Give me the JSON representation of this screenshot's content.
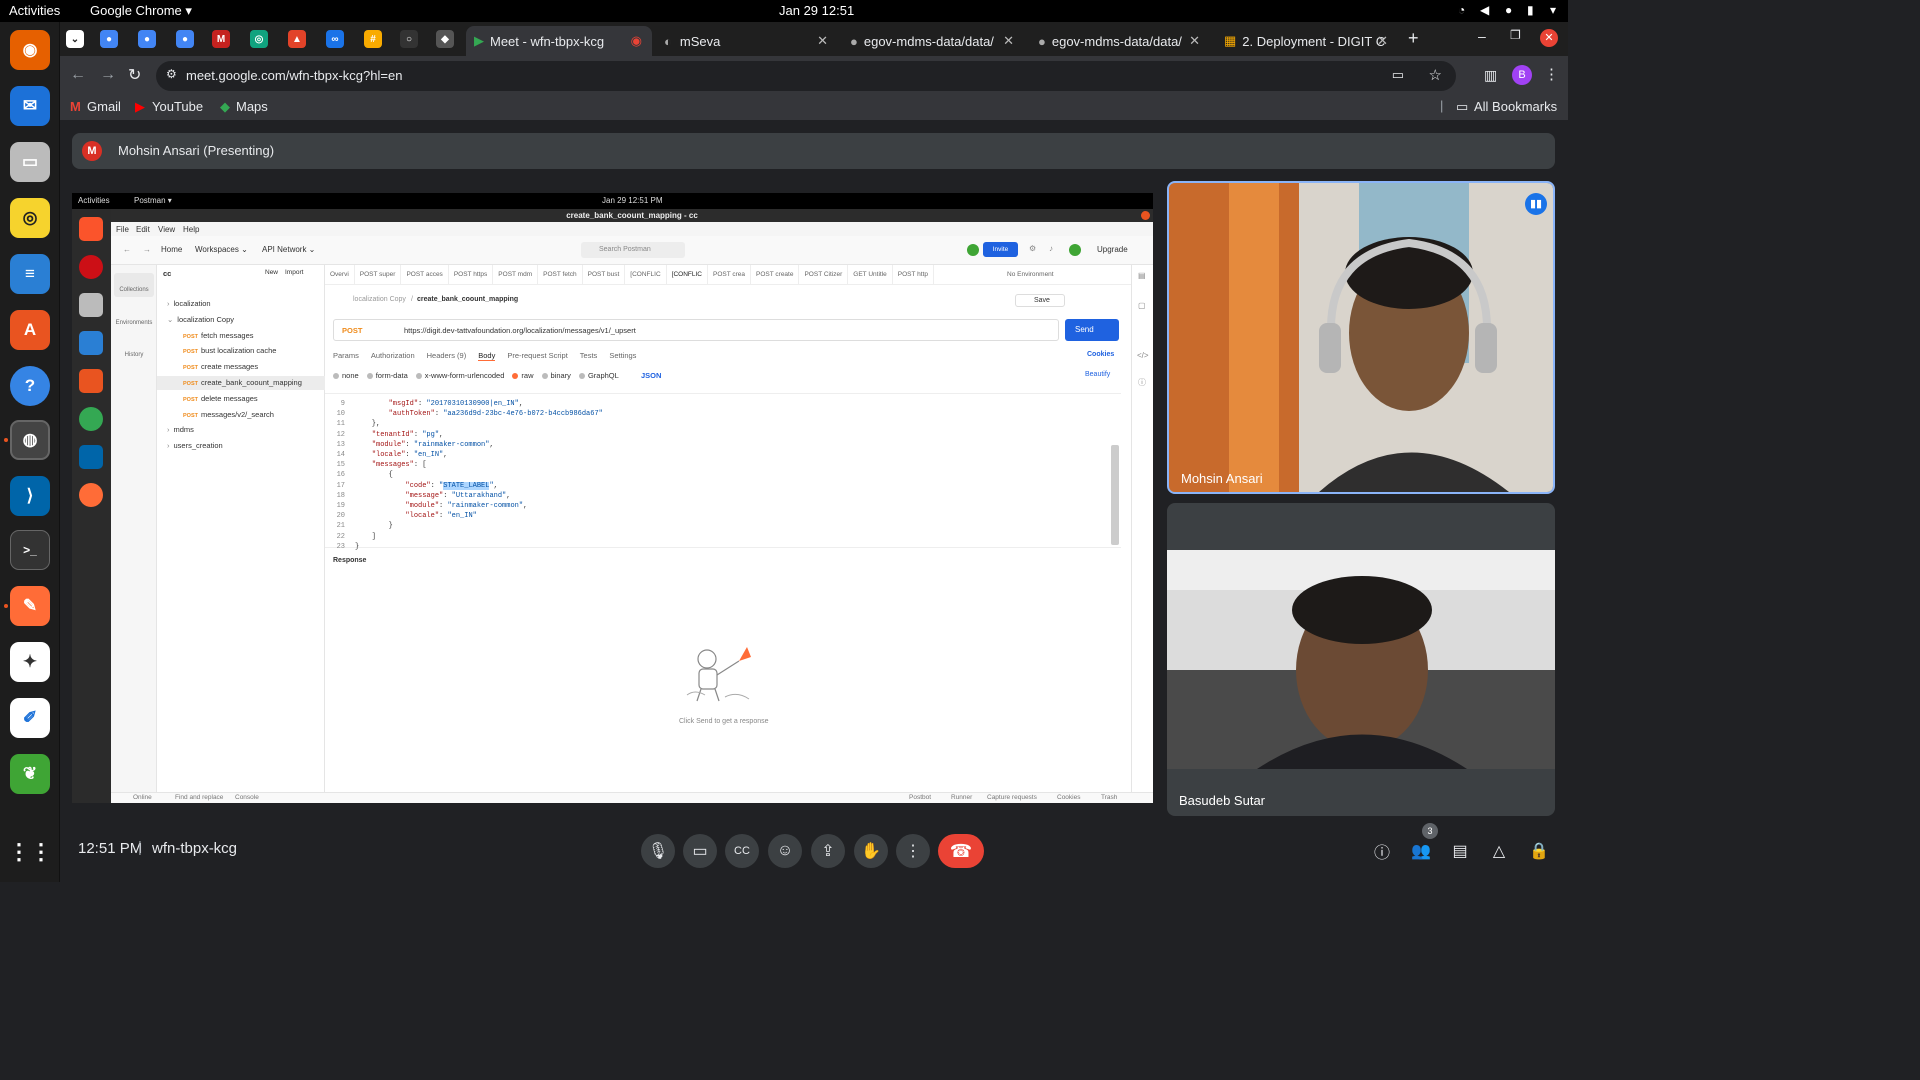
{
  "os": {
    "activities": "Activities",
    "app": "Google Chrome ▾",
    "datetime": "Jan 29  12:51"
  },
  "chrome": {
    "tabs": [
      {
        "label": "Meet - wfn-tbpx-kcg"
      },
      {
        "label": "mSeva"
      },
      {
        "label": "egov-mdms-data/data/"
      },
      {
        "label": "egov-mdms-data/data/"
      },
      {
        "label": "2. Deployment - DIGIT C"
      }
    ],
    "url": "meet.google.com/wfn-tbpx-kcg?hl=en",
    "bookmarks": [
      "Gmail",
      "YouTube",
      "Maps"
    ],
    "all_bookmarks": "All Bookmarks",
    "profile_initial": "B"
  },
  "meet": {
    "presenting": "Mohsin Ansari (Presenting)",
    "presenter_initial": "M",
    "time": "12:51 PM",
    "separator": "|",
    "code": "wfn-tbpx-kcg",
    "participant_count": "3",
    "participants": [
      {
        "name": "Mohsin Ansari"
      },
      {
        "name": "Basudeb Sutar"
      }
    ]
  },
  "postman": {
    "topbar_activities": "Activities",
    "topbar_app": "Postman ▾",
    "topbar_date": "Jan 29  12:51 PM",
    "window_title": "create_bank_coount_mapping - cc",
    "menu": [
      "File",
      "Edit",
      "View",
      "Help"
    ],
    "nav": {
      "home": "Home",
      "workspaces": "Workspaces ⌄",
      "network": "API Network ⌄",
      "search": "Search Postman",
      "invite": "Invite",
      "upgrade": "Upgrade"
    },
    "workspace": "cc",
    "new": "New",
    "import": "Import",
    "side": [
      "Collections",
      "Environments",
      "History"
    ],
    "tree": [
      {
        "label": "localization",
        "method": "",
        "caret": "›"
      },
      {
        "label": "localization Copy",
        "method": "",
        "caret": "⌄"
      },
      {
        "label": "fetch messages",
        "method": "POST",
        "caret": ""
      },
      {
        "label": "bust localization cache",
        "method": "POST",
        "caret": ""
      },
      {
        "label": "create messages",
        "method": "POST",
        "caret": ""
      },
      {
        "label": "create_bank_coount_mapping",
        "method": "POST",
        "caret": ""
      },
      {
        "label": "delete messages",
        "method": "POST",
        "caret": ""
      },
      {
        "label": "messages/v2/_search",
        "method": "POST",
        "caret": ""
      },
      {
        "label": "mdms",
        "method": "",
        "caret": "›"
      },
      {
        "label": "users_creation",
        "method": "",
        "caret": "›"
      }
    ],
    "req_tabs": [
      "Overvi",
      "POST super",
      "POST acces",
      "POST https",
      "POST mdm",
      "POST fetch",
      "POST bust",
      "[CONFLIC",
      "[CONFLIC",
      "POST crea",
      "POST create",
      "POST Citizer",
      "GET Untitle",
      "POST http"
    ],
    "environment": "No Environment",
    "breadcrumb_parent": "localization Copy",
    "breadcrumb_sep": "/",
    "request_name": "create_bank_coount_mapping",
    "save": "Save",
    "method": "POST",
    "url": "https://digit.dev-tattvafoundation.org/localization/messages/v1/_upsert",
    "send": "Send",
    "subtabs": [
      "Params",
      "Authorization",
      "Headers (9)",
      "Body",
      "Pre-request Script",
      "Tests",
      "Settings"
    ],
    "cookies": "Cookies",
    "body_types": [
      "none",
      "form-data",
      "x-www-form-urlencoded",
      "raw",
      "binary",
      "GraphQL"
    ],
    "body_format": "JSON",
    "beautify": "Beautify",
    "code_lines": [
      {
        "n": "9",
        "t": "        \"msgId\": \"20170310130900|en_IN\","
      },
      {
        "n": "10",
        "t": "        \"authToken\": \"aa236d9d-23bc-4e76-b072-b4ccb986da67\""
      },
      {
        "n": "11",
        "t": "    },"
      },
      {
        "n": "12",
        "t": "    \"tenantId\": \"pg\","
      },
      {
        "n": "13",
        "t": "    \"module\": \"rainmaker-common\","
      },
      {
        "n": "14",
        "t": "    \"locale\": \"en_IN\","
      },
      {
        "n": "15",
        "t": "    \"messages\": ["
      },
      {
        "n": "16",
        "t": "        {"
      },
      {
        "n": "17",
        "t": "            \"code\": \"STATE_LABEL\","
      },
      {
        "n": "18",
        "t": "            \"message\": \"Uttarakhand\","
      },
      {
        "n": "19",
        "t": "            \"module\": \"rainmaker-common\","
      },
      {
        "n": "20",
        "t": "            \"locale\": \"en_IN\""
      },
      {
        "n": "21",
        "t": "        }"
      },
      {
        "n": "22",
        "t": "    ]"
      },
      {
        "n": "23",
        "t": "}"
      }
    ],
    "response": "Response",
    "empty_hint": "Click Send to get a response",
    "status_left": [
      "Online",
      "Find and replace",
      "Console"
    ],
    "status_right": [
      "Postbot",
      "Runner",
      "Capture requests",
      "Cookies",
      "Trash"
    ]
  },
  "colors": {
    "accent_blue": "#8ab4f8",
    "end_call": "#ea4335",
    "postman_orange": "#ff6c37",
    "send_blue": "#1f62e0"
  }
}
